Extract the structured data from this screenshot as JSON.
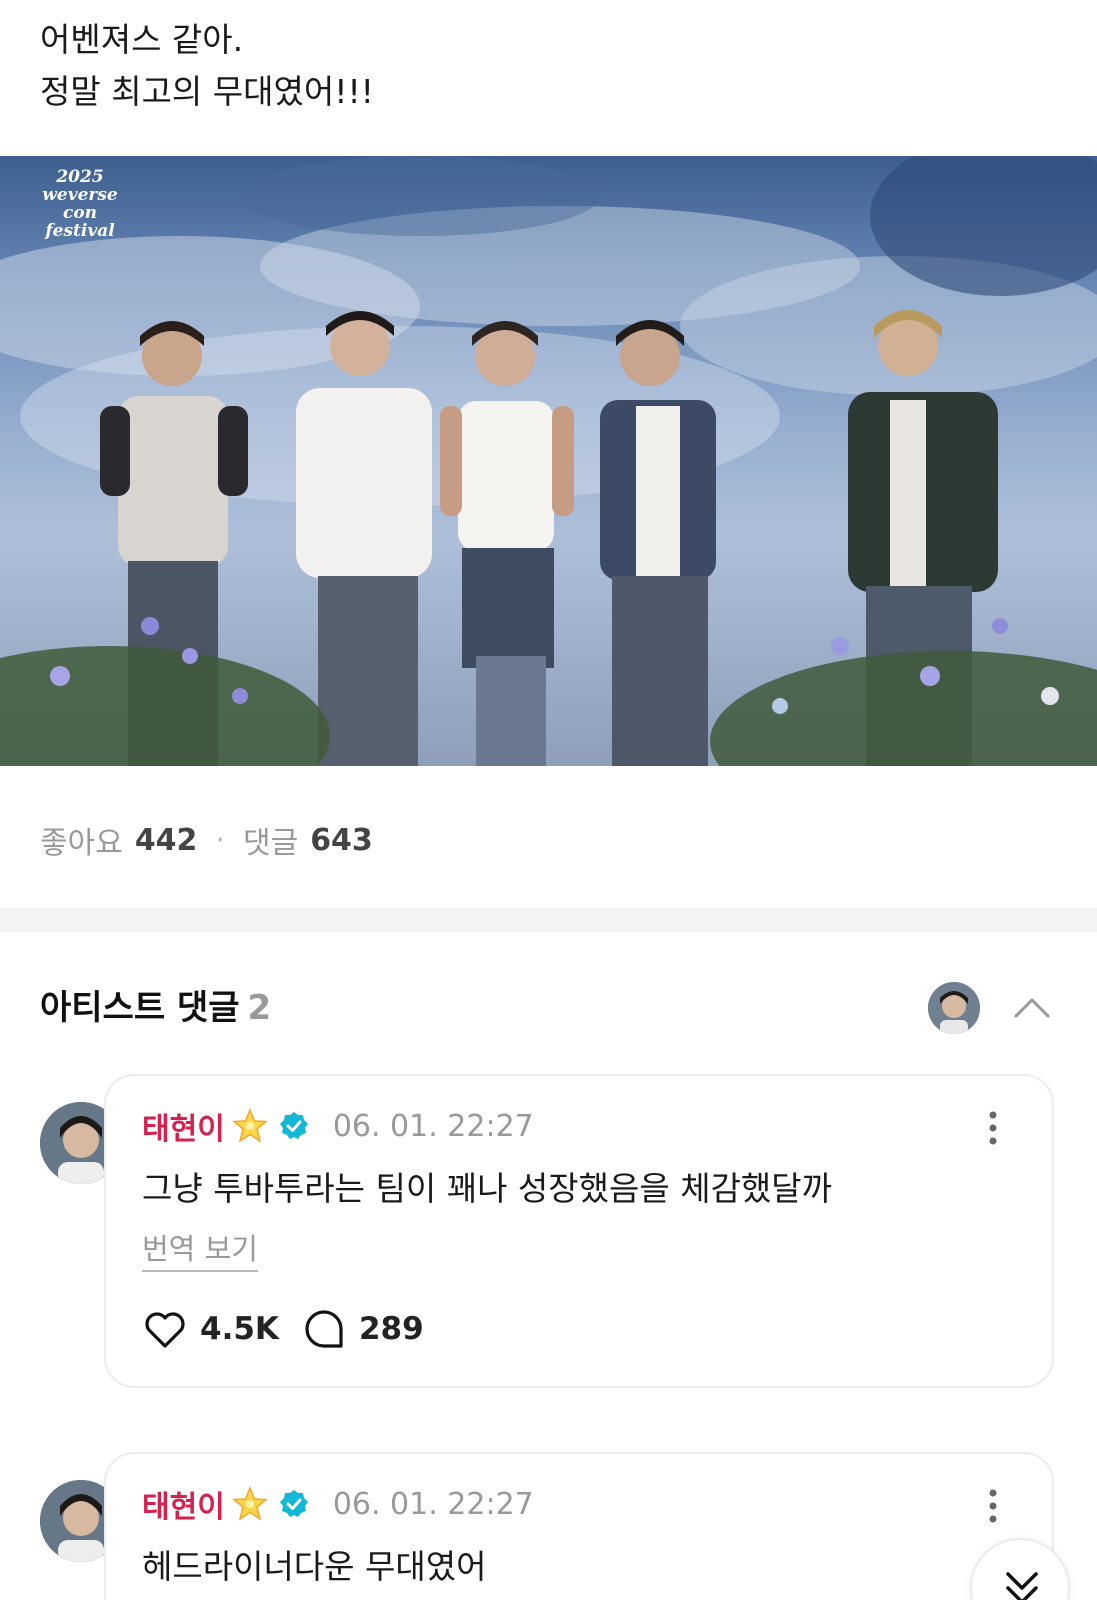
{
  "post": {
    "lines": [
      "어벤져스 같아.",
      "정말 최고의 무대였어!!!"
    ],
    "image_logo": [
      "2025",
      "weverse",
      "con",
      "festival"
    ]
  },
  "stats": {
    "likes_label": "좋아요",
    "likes_count": "442",
    "separator": "·",
    "comments_label": "댓글",
    "comments_count": "643"
  },
  "artist_comments": {
    "title": "아티스트 댓글",
    "count": "2",
    "items": [
      {
        "name": "태현이",
        "time": "06. 01. 22:27",
        "text": "그냥 투바투라는 팀이 꽤나 성장했음을 체감했달까",
        "translate": "번역 보기",
        "likes": "4.5K",
        "replies": "289"
      },
      {
        "name": "태현이",
        "time": "06. 01. 22:27",
        "text": "헤드라이너다운 무대였어"
      }
    ]
  },
  "colors": {
    "name": "#d6214e",
    "verified": "#13b8d6",
    "muted": "#999999",
    "divider": "#f3f3f5"
  },
  "icons": [
    "crown-star-icon",
    "verified-icon",
    "more-vertical-icon",
    "heart-icon",
    "comment-bubble-icon",
    "chevron-up-icon",
    "chevron-double-down-icon"
  ]
}
